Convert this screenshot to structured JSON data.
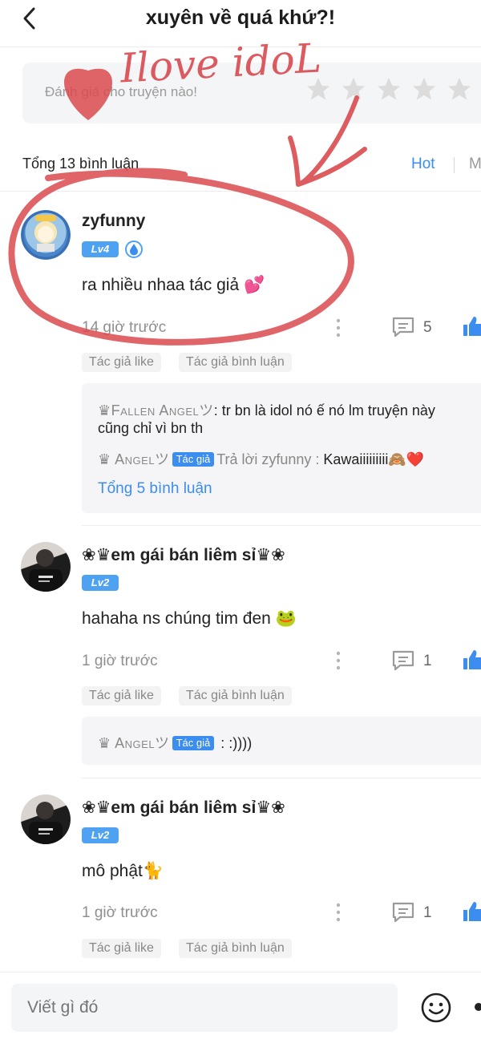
{
  "header": {
    "title": "xuyên về quá khứ?!"
  },
  "rating": {
    "placeholder": "Đánh giá cho truyện nào!",
    "star_count": 5
  },
  "comments_header": {
    "total": "Tổng 13 bình luận",
    "sort_hot": "Hot",
    "sort_new": "M"
  },
  "comments": [
    {
      "username": "zyfunny",
      "level": "Lv4",
      "text": "ra nhiều nhaa tác giả 💕",
      "time": "14 giờ trước",
      "reply_count": "5",
      "tags": [
        "Tác giả like",
        "Tác giả bình luận"
      ],
      "replies": [
        {
          "name": "♛Fallen Angelツ",
          "text": ": tr bn là idol nó ế nó lm truyện này",
          "text2": "cũng chỉ vì bn th"
        },
        {
          "name": "♛ Angelツ",
          "badge": "Tác giả",
          "prefix": "Trả lời zyfunny :",
          "text": " Kawaiiiiiiiii🙈❤️"
        }
      ],
      "replies_total": "Tổng 5 bình luận"
    },
    {
      "username": "❀♛em gái bán liêm sỉ♛❀",
      "level": "Lv2",
      "text": "hahaha ns chúng tim đen 🐸",
      "time": "1 giờ trước",
      "reply_count": "1",
      "tags": [
        "Tác giả like",
        "Tác giả bình luận"
      ],
      "replies": [
        {
          "name": "♛ Angelツ",
          "badge": "Tác giả",
          "text": " : :))))"
        }
      ]
    },
    {
      "username": "❀♛em gái bán liêm sỉ♛❀",
      "level": "Lv2",
      "text": "mô phật🐈",
      "time": "1 giờ trước",
      "reply_count": "1",
      "tags": [
        "Tác giả like",
        "Tác giả bình luận"
      ]
    }
  ],
  "composer": {
    "placeholder": "Viết gì đó"
  },
  "annotation": {
    "text": "Ilove idoL"
  },
  "colors": {
    "accent": "#3b8df0",
    "badge": "#4fa2f2",
    "scribble": "#d94a4f"
  }
}
